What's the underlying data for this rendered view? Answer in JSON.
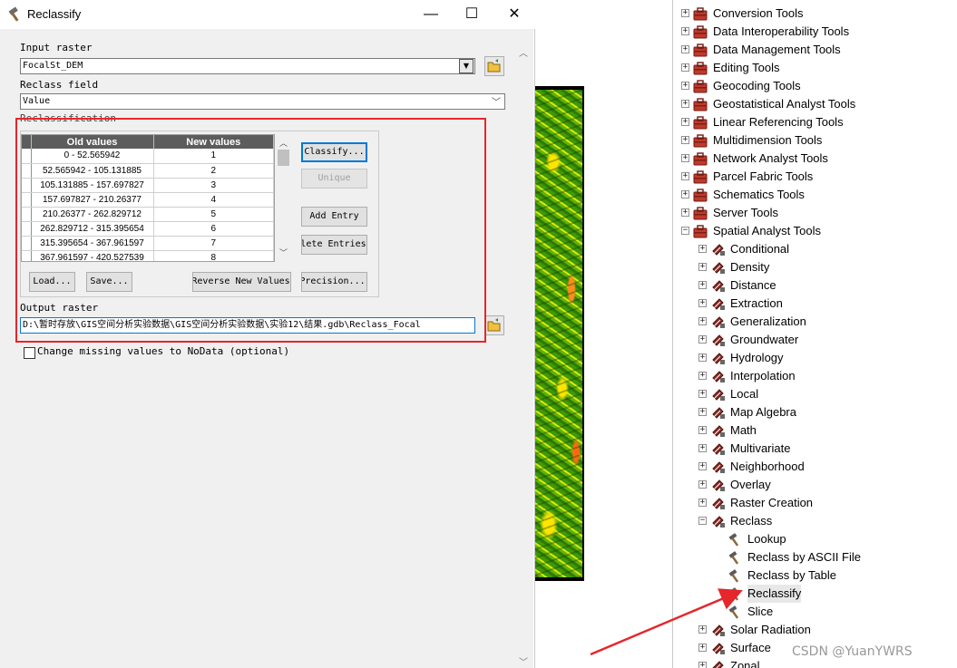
{
  "dialog": {
    "title": "Reclassify",
    "minimize": "—",
    "maximize": "☐",
    "close": "✕",
    "input_raster_label": "Input raster",
    "input_raster_value": "FocalSt_DEM",
    "reclass_field_label": "Reclass field",
    "reclass_field_value": "Value",
    "reclassification_label": "Reclassification",
    "table": {
      "headers": [
        "Old values",
        "New values"
      ],
      "rows": [
        [
          "0 - 52.565942",
          "1"
        ],
        [
          "52.565942 - 105.131885",
          "2"
        ],
        [
          "105.131885 - 157.697827",
          "3"
        ],
        [
          "157.697827 - 210.26377",
          "4"
        ],
        [
          "210.26377 - 262.829712",
          "5"
        ],
        [
          "262.829712 - 315.395654",
          "6"
        ],
        [
          "315.395654 - 367.961597",
          "7"
        ],
        [
          "367.961597 - 420.527539",
          "8"
        ]
      ]
    },
    "buttons": {
      "classify": "Classify...",
      "unique": "Unique",
      "add_entry": "Add Entry",
      "delete_entries": "Delete Entries",
      "load": "Load...",
      "save": "Save...",
      "reverse": "Reverse New Values",
      "precision": "Precision..."
    },
    "output_raster_label": "Output raster",
    "output_raster_value": "D:\\暂时存放\\GIS空间分析实验数据\\GIS空间分析实验数据\\实验12\\结果.gdb\\Reclass_Focal",
    "nodata_checkbox_label": "Change missing values to NoData (optional)"
  },
  "toolbox": {
    "top_items": [
      "Conversion Tools",
      "Data Interoperability Tools",
      "Data Management Tools",
      "Editing Tools",
      "Geocoding Tools",
      "Geostatistical Analyst Tools",
      "Linear Referencing Tools",
      "Multidimension Tools",
      "Network Analyst Tools",
      "Parcel Fabric Tools",
      "Schematics Tools",
      "Server Tools",
      "Spatial Analyst Tools"
    ],
    "spatial_children": [
      "Conditional",
      "Density",
      "Distance",
      "Extraction",
      "Generalization",
      "Groundwater",
      "Hydrology",
      "Interpolation",
      "Local",
      "Map Algebra",
      "Math",
      "Multivariate",
      "Neighborhood",
      "Overlay",
      "Raster Creation",
      "Reclass"
    ],
    "reclass_tools": [
      "Lookup",
      "Reclass by ASCII File",
      "Reclass by Table",
      "Reclassify",
      "Slice"
    ],
    "after_items": [
      "Solar Radiation",
      "Surface",
      "Zonal"
    ],
    "selected": "Reclassify"
  },
  "watermark": "CSDN @YuanYWRS",
  "colors": {
    "highlight_box": "#e5262b",
    "arrow": "#e5262b",
    "toolbox_icon": "#c0392b"
  }
}
